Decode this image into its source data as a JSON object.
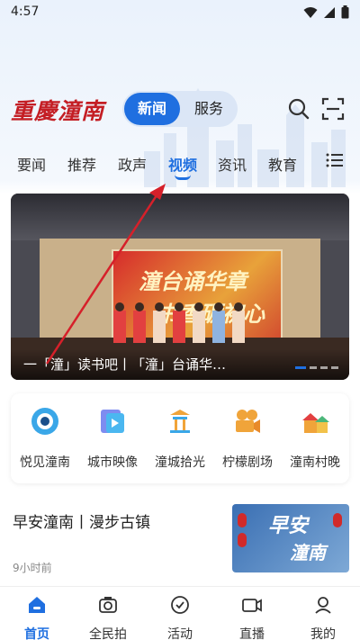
{
  "status_bar": {
    "time": "4:57"
  },
  "header": {
    "logo_text": "重慶潼南",
    "segment": {
      "active_label": "新闻",
      "inactive_label": "服务"
    }
  },
  "tabs": [
    {
      "label": "要闻",
      "active": false
    },
    {
      "label": "推荐",
      "active": false
    },
    {
      "label": "政声",
      "active": false
    },
    {
      "label": "视频",
      "active": true
    },
    {
      "label": "资讯",
      "active": false
    },
    {
      "label": "教育",
      "active": false
    }
  ],
  "banner": {
    "screen_title_line1": "潼台诵华章",
    "screen_title_line2": "书香砺初心",
    "caption": "一「潼」读书吧丨「潼」台诵华…"
  },
  "shortcuts": [
    {
      "label": "悦见潼南",
      "icon": "eye-icon"
    },
    {
      "label": "城市映像",
      "icon": "video-album-icon"
    },
    {
      "label": "潼城拾光",
      "icon": "pavilion-icon"
    },
    {
      "label": "柠檬剧场",
      "icon": "film-camera-icon"
    },
    {
      "label": "潼南村晚",
      "icon": "village-icon"
    }
  ],
  "news": {
    "headline": "早安潼南丨漫步古镇",
    "time": "9小时前",
    "thumb_text_line1": "早安",
    "thumb_text_line2": "潼南"
  },
  "bottom_nav": [
    {
      "label": "首页",
      "icon": "home-icon",
      "active": true
    },
    {
      "label": "全民拍",
      "icon": "camera-icon",
      "active": false
    },
    {
      "label": "活动",
      "icon": "activity-icon",
      "active": false
    },
    {
      "label": "直播",
      "icon": "live-video-icon",
      "active": false
    },
    {
      "label": "我的",
      "icon": "profile-icon",
      "active": false
    }
  ],
  "colors": {
    "accent": "#1f6fe0",
    "logo_red": "#c41e24",
    "annotation_arrow": "#d6202a"
  }
}
